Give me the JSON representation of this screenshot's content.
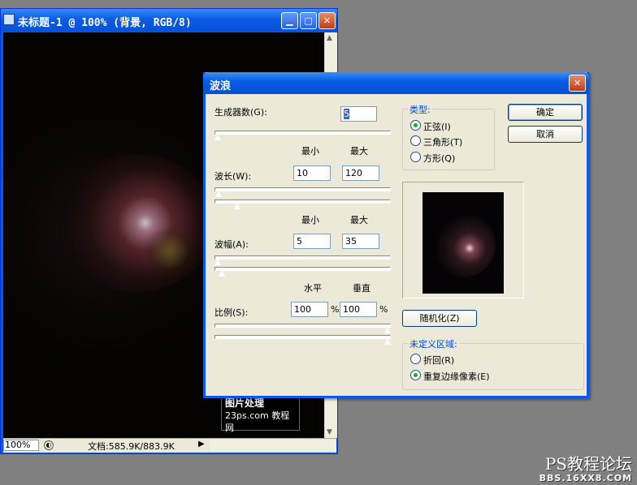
{
  "document_window": {
    "title": "未标题-1 @ 100% (背景, RGB/8)",
    "zoom": "100%",
    "doc_info": "文档:585.9K/883.9K"
  },
  "dialog": {
    "title": "波浪",
    "generators_label": "生成器数(G):",
    "generators_value": "5",
    "col_min": "最小",
    "col_max": "最大",
    "wavelength_label": "波长(W):",
    "wavelength_min": "10",
    "wavelength_max": "120",
    "amplitude_label": "波幅(A):",
    "amplitude_min": "5",
    "amplitude_max": "35",
    "col_horizontal": "水平",
    "col_vertical": "垂直",
    "scale_label": "比例(S):",
    "scale_h": "100",
    "scale_v": "100",
    "percent": "%",
    "type_group_title": "类型:",
    "type_options": [
      "正弦(I)",
      "三角形(T)",
      "方形(Q)"
    ],
    "type_selected": "正弦(I)",
    "ok_label": "确定",
    "cancel_label": "取消",
    "randomize_label": "随机化(Z)",
    "undefined_group_title": "未定义区域:",
    "undefined_options": [
      "折回(R)",
      "重复边缘像素(E)"
    ],
    "undefined_selected": "重复边缘像素(E)"
  },
  "watermark": {
    "line1": "图片处理",
    "line2": "23ps.com 教程网"
  },
  "corner_watermark": {
    "title": "PS教程论坛",
    "url": "BBS.16XX8.COM"
  },
  "colors": {
    "titlebar": "#0a5be4",
    "dialog_bg": "#ece9d8",
    "desktop": "#808080",
    "group_title": "#0046d5"
  }
}
